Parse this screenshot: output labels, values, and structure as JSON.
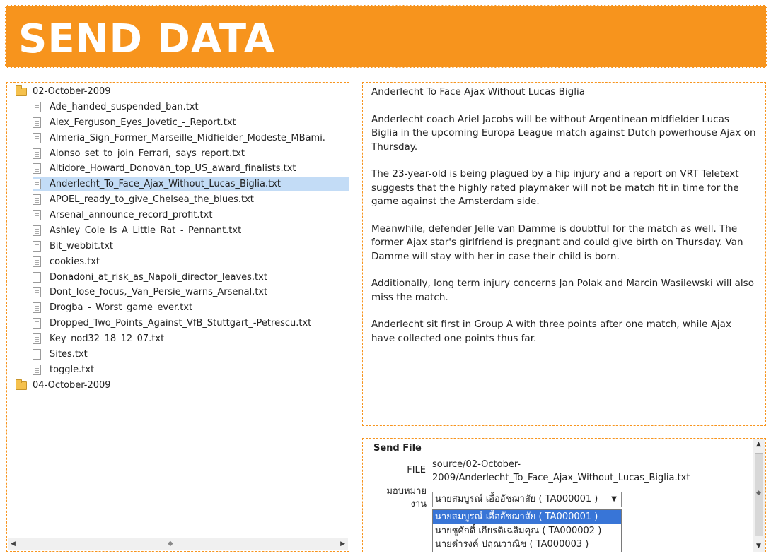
{
  "header": {
    "title": "SEND DATA"
  },
  "tree": {
    "folders": [
      {
        "name": "02-October-2009",
        "expanded": true
      },
      {
        "name": "04-October-2009",
        "expanded": false
      }
    ],
    "files": [
      "Ade_handed_suspended_ban.txt",
      "Alex_Ferguson_Eyes_Jovetic_-_Report.txt",
      "Almeria_Sign_Former_Marseille_Midfielder_Modeste_MBami.",
      "Alonso_set_to_join_Ferrari,_says_report.txt",
      "Altidore_Howard_Donovan_top_US_award_finalists.txt",
      "Anderlecht_To_Face_Ajax_Without_Lucas_Biglia.txt",
      "APOEL_ready_to_give_Chelsea_the_blues.txt",
      "Arsenal_announce_record_profit.txt",
      "Ashley_Cole_Is_A_Little_Rat_-_Pennant.txt",
      "Bit_webbit.txt",
      "cookies.txt",
      "Donadoni_at_risk_as_Napoli_director_leaves.txt",
      "Dont_lose_focus,_Van_Persie_warns_Arsenal.txt",
      "Drogba_-_Worst_game_ever.txt",
      "Dropped_Two_Points_Against_VfB_Stuttgart_-Petrescu.txt",
      "Key_nod32_18_12_07.txt",
      "Sites.txt",
      "toggle.txt"
    ],
    "selected_file": "Anderlecht_To_Face_Ajax_Without_Lucas_Biglia.txt"
  },
  "article": {
    "title": "Anderlecht To Face Ajax Without Lucas Biglia",
    "paragraphs": [
      "Anderlecht coach Ariel Jacobs will be without Argentinean midfielder Lucas Biglia in the upcoming Europa League match against Dutch powerhouse Ajax on Thursday.",
      "The 23-year-old is being plagued by a hip injury and a report on VRT Teletext suggests that the highly rated playmaker will not be match fit in time for the game against the Amsterdam side.",
      "Meanwhile, defender Jelle van Damme is doubtful for the match as well. The former Ajax star's girlfriend is pregnant and could give birth on Thursday. Van Damme will stay with her in case their child is born.",
      "Additionally, long term injury concerns Jan Polak and Marcin Wasilewski will also miss the match.",
      "Anderlecht sit first in Group A with three points after one match, while Ajax have collected one points thus far."
    ]
  },
  "send_file": {
    "title": "Send File",
    "file_label": "FILE",
    "file_value": "source/02-October-2009/Anderlecht_To_Face_Ajax_Without_Lucas_Biglia.txt",
    "assign_label": "มอบหมายงาน",
    "selected": "นายสมบูรณ์ เอื้ออัชฌาสัย ( TA000001 )",
    "options": [
      "นายสมบูรณ์ เอื้ออัชฌาสัย ( TA000001 )",
      "นายชูศักดิ์ เกียรติเฉลิมคุณ ( TA000002 )",
      "นายดำรงค์ ปฤณวาณิช ( TA000003 )"
    ]
  },
  "icons": {
    "folder": "folder-icon",
    "file": "file-icon",
    "dropdown": "chevron-down-icon"
  }
}
